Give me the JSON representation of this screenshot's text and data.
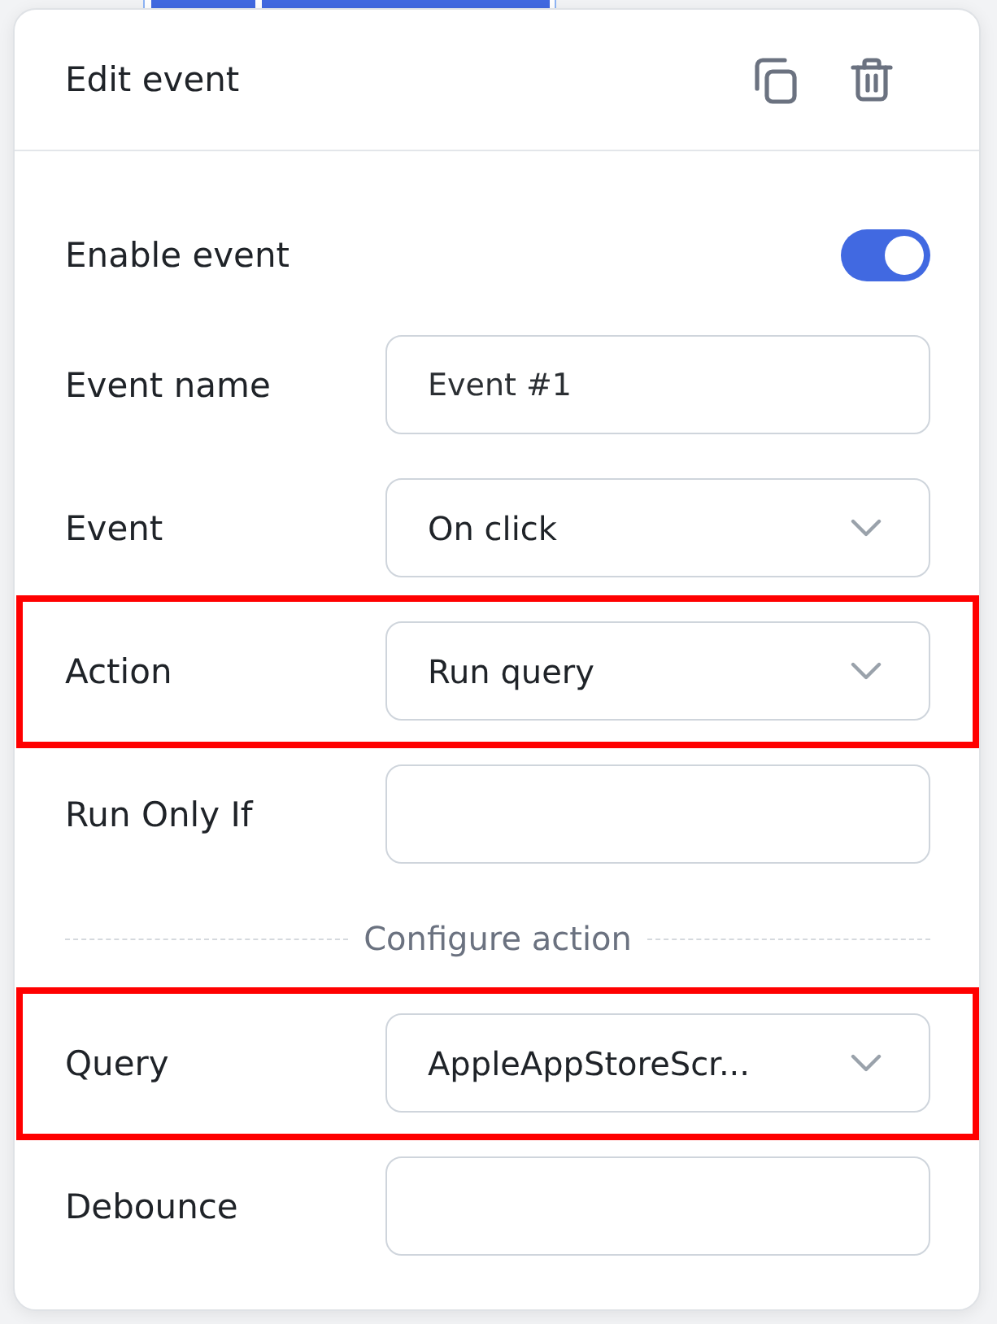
{
  "header": {
    "title": "Edit event"
  },
  "fields": [
    {
      "kind": "toggle",
      "label": "Enable event",
      "on": true,
      "highlighted": false
    },
    {
      "kind": "text",
      "label": "Event name",
      "value": "Event #1",
      "highlighted": false
    },
    {
      "kind": "select",
      "label": "Event",
      "value": "On click",
      "highlighted": false
    },
    {
      "kind": "select",
      "label": "Action",
      "value": "Run query",
      "highlighted": true
    },
    {
      "kind": "text",
      "label": "Run Only If",
      "highlighted": false
    },
    {
      "kind": "divider",
      "label": "Configure action",
      "highlighted": false
    },
    {
      "kind": "select",
      "label": "Query",
      "value": "AppleAppStoreScr...",
      "highlighted": true
    },
    {
      "kind": "text",
      "label": "Debounce",
      "highlighted": false
    }
  ]
}
